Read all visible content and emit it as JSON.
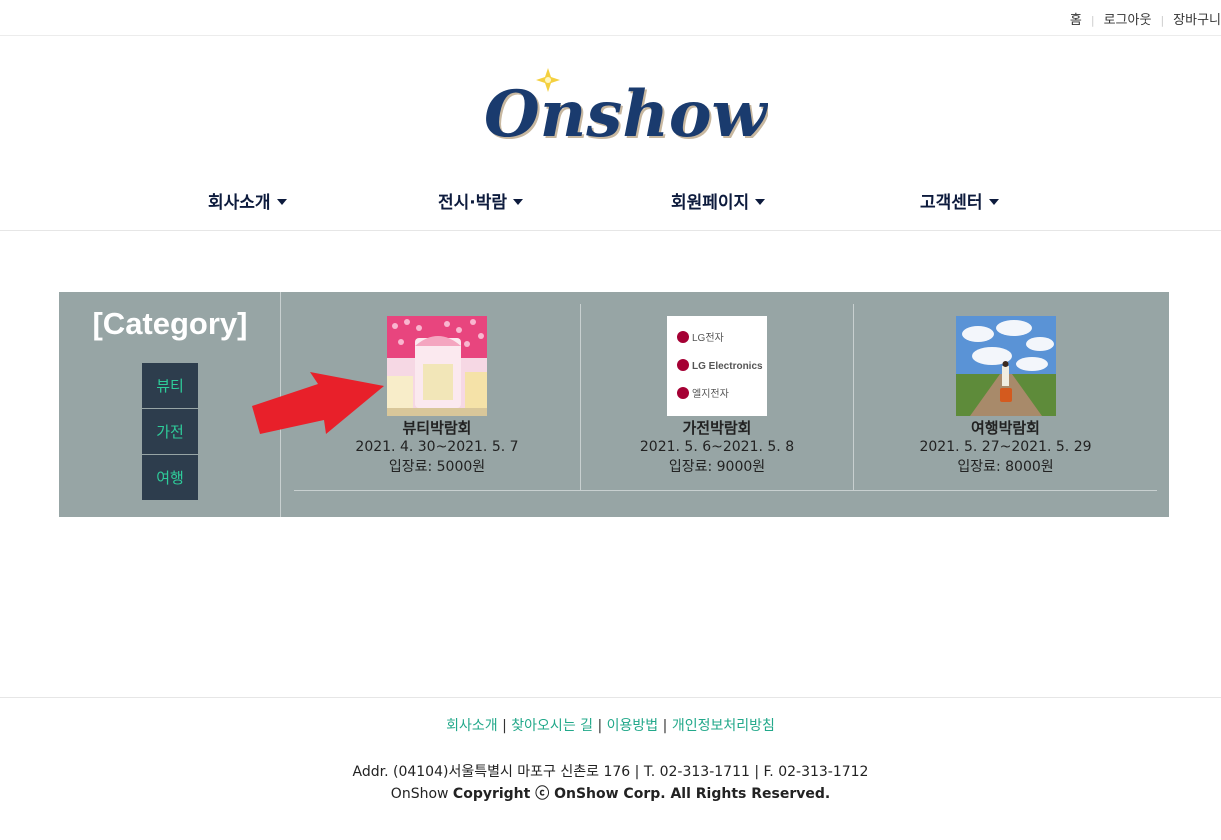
{
  "topbar": {
    "links": [
      "홈",
      "로그아웃",
      "장바구니"
    ]
  },
  "logo": {
    "text": "Onshow"
  },
  "nav": {
    "items": [
      "회사소개",
      "전시·박람",
      "회원페이지",
      "고객센터"
    ]
  },
  "category": {
    "title": "[Category]",
    "items": [
      "뷰티",
      "가전",
      "여행"
    ]
  },
  "expos": [
    {
      "name": "뷰티박람회",
      "date": "2021. 4. 30~2021. 5. 7",
      "fee": "입장료: 5000원",
      "image": "beauty-store-photo"
    },
    {
      "name": "가전박람회",
      "date": "2021. 5. 6~2021. 5. 8",
      "fee": "입장료: 9000원",
      "image": "lg-electronics-logo",
      "image_text": [
        "LG전자",
        "LG Electronics",
        "엘지전자"
      ]
    },
    {
      "name": "여행박람회",
      "date": "2021. 5. 27~2021. 5. 29",
      "fee": "입장료: 8000원",
      "image": "travel-road-photo"
    }
  ],
  "annotation": {
    "icon": "red-arrow-icon",
    "color": "#e8202a"
  },
  "footer": {
    "links": [
      "회사소개",
      "찾아오시는 길",
      "이용방법",
      "개인정보처리방침"
    ],
    "separator": " | ",
    "address": "Addr. (04104)서울특별시 마포구 신촌로 176 | T. 02-313-1711 | F. 02-313-1712",
    "copyright_prefix": "OnShow ",
    "copyright_bold": "Copyright ⓒ OnShow Corp. All Rights Reserved."
  },
  "colors": {
    "nav_text": "#0d1b3d",
    "panel_bg": "#97a5a5",
    "category_btn_bg": "#2d3d4d",
    "category_btn_text": "#2ecc9a",
    "footer_link": "#22a88a"
  }
}
